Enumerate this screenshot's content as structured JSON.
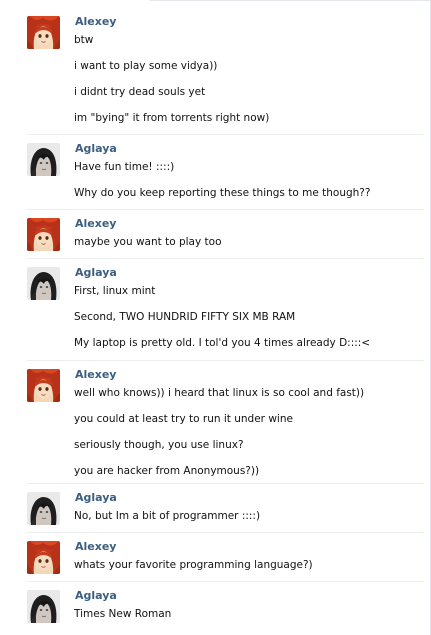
{
  "conversation": [
    {
      "author": "Alexey",
      "avatar": "redhead-avatar-icon",
      "messages": [
        "btw",
        "i want to play some vidya))",
        "i didnt try dead souls yet",
        "im \"bying\" it from torrents right now)"
      ]
    },
    {
      "author": "Aglaya",
      "avatar": "dark-hair-avatar-icon",
      "messages": [
        "Have fun time! ::::)",
        "Why do you keep reporting these things to me though??"
      ]
    },
    {
      "author": "Alexey",
      "avatar": "redhead-avatar-icon",
      "messages": [
        "maybe you want to play too"
      ]
    },
    {
      "author": "Aglaya",
      "avatar": "dark-hair-avatar-icon",
      "messages": [
        "First, linux mint",
        "Second, TWO HUNDRID FIFTY SIX MB RAM",
        "My laptop is pretty old. I tol'd you 4 times already D::::<"
      ]
    },
    {
      "author": "Alexey",
      "avatar": "redhead-avatar-icon",
      "messages": [
        "well who knows)) i heard that linux is so cool and fast))",
        "you could at least try to run it under wine",
        "seriously though, you use linux?",
        "you are hacker from Anonymous?))"
      ]
    },
    {
      "author": "Aglaya",
      "avatar": "dark-hair-avatar-icon",
      "messages": [
        "No, but Im a bit of programmer ::::)"
      ]
    },
    {
      "author": "Alexey",
      "avatar": "redhead-avatar-icon",
      "messages": [
        "whats your favorite programming language?)"
      ]
    },
    {
      "author": "Aglaya",
      "avatar": "dark-hair-avatar-icon",
      "messages": [
        "Times New Roman"
      ]
    }
  ]
}
